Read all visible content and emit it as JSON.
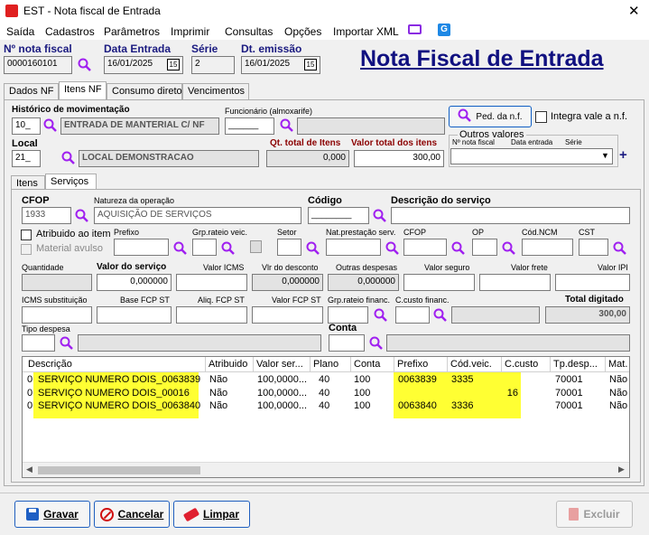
{
  "window": {
    "title": "EST - Nota fiscal de Entrada"
  },
  "menu": [
    "Saída",
    "Cadastros",
    "Parâmetros",
    "Imprimir",
    "Consultas",
    "Opções",
    "Importar XML"
  ],
  "header": {
    "nota_label": "Nº nota fiscal",
    "nota_value": "0000160101",
    "data_entrada_label": "Data Entrada",
    "data_entrada_value": "16/01/2025",
    "serie_label": "Série",
    "serie_value": "2",
    "emissao_label": "Dt. emissão",
    "emissao_value": "16/01/2025",
    "big_title": "Nota Fiscal de Entrada"
  },
  "tabs": [
    "Dados NF",
    "Itens NF",
    "Consumo direto",
    "Vencimentos"
  ],
  "itens": {
    "hist_label": "Histórico de movimentação",
    "hist_code": "10_",
    "hist_desc": "ENTRADA DE MANTERIAL C/ NF",
    "func_label": "Funcionário (almoxarife)",
    "func_code": "______",
    "ped_button": "Ped. da n.f.",
    "integra_label": "Integra vale a n.f.",
    "local_label": "Local",
    "local_code": "21_",
    "local_desc": "LOCAL DEMONSTRACAO",
    "qt_label": "Qt. total de Itens",
    "qt_value": "0,000",
    "vt_label": "Valor total dos itens",
    "vt_value": "300,00",
    "outros_label": "Outros valores",
    "outros_nota": "Nº nota fiscal",
    "outros_data": "Data entrada",
    "outros_serie": "Série"
  },
  "subtabs": [
    "Itens",
    "Serviços"
  ],
  "serv": {
    "cfop_label": "CFOP",
    "cfop_value": "1933",
    "natureza_label": "Natureza da operação",
    "natureza_value": "AQUISIÇÃO DE SERVIÇOS",
    "codigo_label": "Código",
    "codigo_value": "________",
    "descricao_label": "Descrição do serviço",
    "atrib_label": "Atribuido ao item",
    "material_label": "Material avulso",
    "prefixo_label": "Prefixo",
    "grp_label": "Grp.rateio veic.",
    "setor_label": "Setor",
    "natprest_label": "Nat.prestação serv.",
    "cfop2_label": "CFOP",
    "op_label": "OP",
    "ncm_label": "Cód.NCM",
    "cst_label": "CST",
    "qtd_label": "Quantidade",
    "valor_label": "Valor do serviço",
    "valor_value": "0,000000",
    "icms_label": "Valor ICMS",
    "desc_label": "Vlr do desconto",
    "desc_value": "0,000000",
    "outras_label": "Outras despesas",
    "outras_value": "0,000000",
    "seguro_label": "Valor seguro",
    "frete_label": "Valor frete",
    "ipi_label": "Valor IPI",
    "icmssub_label": "ICMS substituição",
    "bfcp_label": "Base FCP ST",
    "afcp_label": "Aliq. FCP ST",
    "vfcp_label": "Valor FCP ST",
    "grpfin_label": "Grp.rateio financ.",
    "ccfin_label": "C.custo financ.",
    "total_label": "Total digitado",
    "total_value": "300,00",
    "tipo_label": "Tipo despesa",
    "conta_label": "Conta"
  },
  "table": {
    "headers": [
      "Descrição",
      "Atribuido",
      "Valor ser...",
      "Plano",
      "Conta",
      "Prefixo",
      "Cód.veic.",
      "C.custo",
      "Tp.desp...",
      "Mat."
    ],
    "rows": [
      {
        "pre": "0",
        "desc": "SERVIÇO NUMERO DOIS_0063839",
        "atrib": "Não",
        "valor": "100,0000...",
        "plano": "40",
        "conta": "100",
        "prefixo": "0063839",
        "codveic": "3335",
        "ccusto": "",
        "tp": "70001",
        "mat": "Não"
      },
      {
        "pre": "0",
        "desc": "SERVIÇO NUMERO DOIS_00016",
        "atrib": "Não",
        "valor": "100,0000...",
        "plano": "40",
        "conta": "100",
        "prefixo": "",
        "codveic": "",
        "ccusto": "16",
        "tp": "70001",
        "mat": "Não"
      },
      {
        "pre": "0",
        "desc": "SERVIÇO NUMERO DOIS_0063840",
        "atrib": "Não",
        "valor": "100,0000...",
        "plano": "40",
        "conta": "100",
        "prefixo": "0063840",
        "codveic": "3336",
        "ccusto": "",
        "tp": "70001",
        "mat": "Não"
      }
    ]
  },
  "buttons": {
    "gravar": "Gravar",
    "cancelar": "Cancelar",
    "limpar": "Limpar",
    "excluir": "Excluir"
  }
}
